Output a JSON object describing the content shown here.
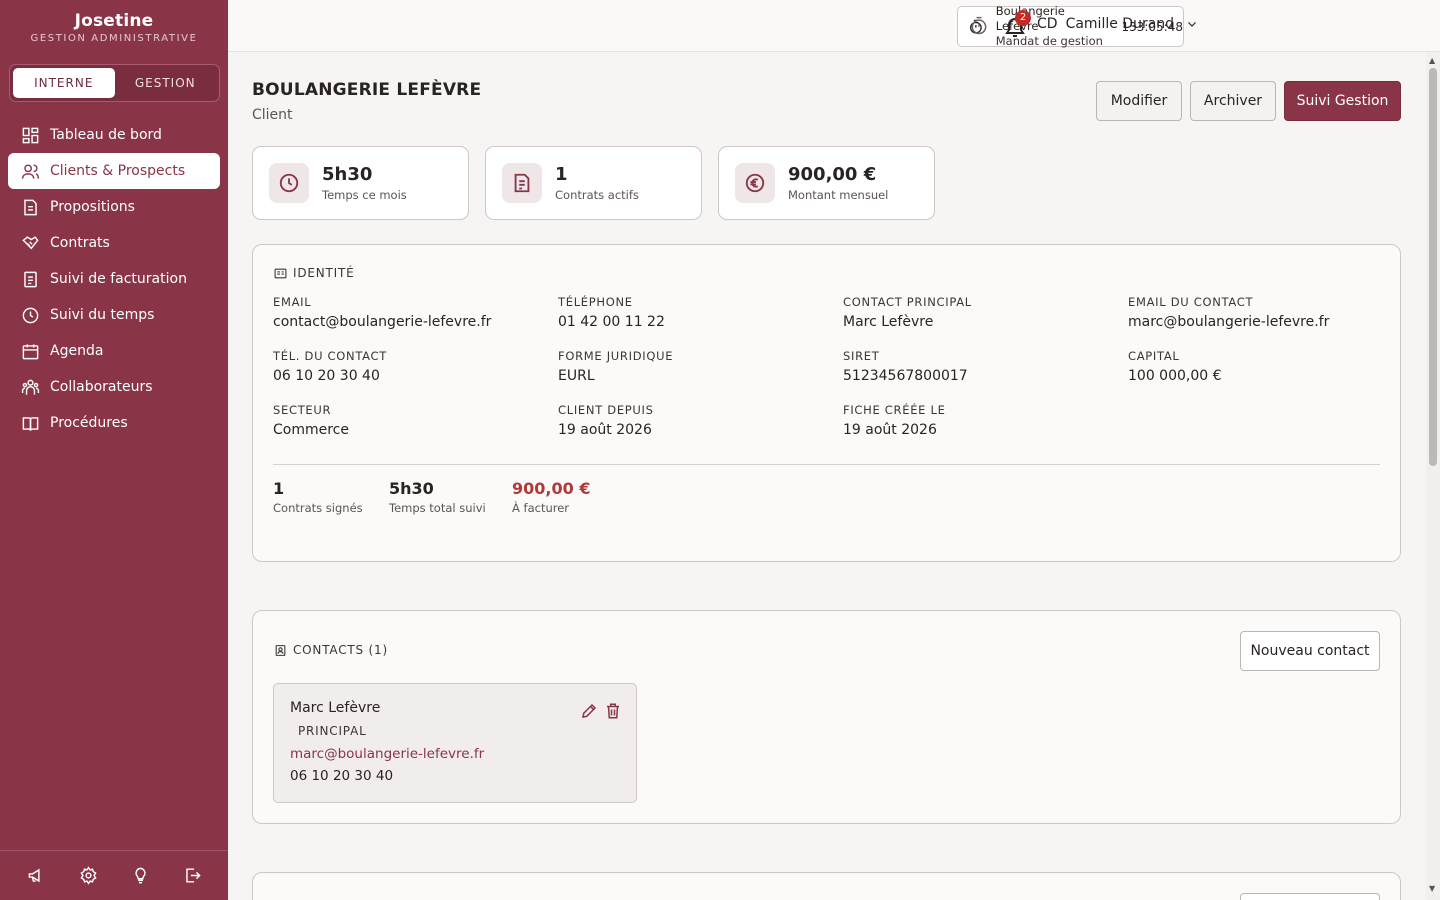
{
  "brand": {
    "name": "Josetine",
    "subtitle": "GESTION ADMINISTRATIVE"
  },
  "mode_toggle": {
    "options": [
      "INTERNE",
      "GESTION"
    ],
    "active": "INTERNE"
  },
  "sidebar": {
    "items": [
      {
        "label": "Tableau de bord",
        "icon": "dashboard-icon"
      },
      {
        "label": "Clients & Prospects",
        "icon": "users-icon",
        "active": true
      },
      {
        "label": "Propositions",
        "icon": "document-icon"
      },
      {
        "label": "Contrats",
        "icon": "handshake-icon"
      },
      {
        "label": "Suivi de facturation",
        "icon": "invoice-icon"
      },
      {
        "label": "Suivi du temps",
        "icon": "clock-icon"
      },
      {
        "label": "Agenda",
        "icon": "calendar-icon"
      },
      {
        "label": "Collaborateurs",
        "icon": "team-icon"
      },
      {
        "label": "Procédures",
        "icon": "book-icon"
      }
    ],
    "footer_icons": [
      "megaphone-icon",
      "settings-icon",
      "lightbulb-icon",
      "logout-icon"
    ]
  },
  "topbar": {
    "timer": {
      "title": "Boulangerie Lefèvre",
      "subtitle": "Mandat de gestion",
      "elapsed": "133:05:48"
    },
    "notifications_count": "2",
    "user": {
      "initials": "CD",
      "name": "Camille Durand"
    }
  },
  "page": {
    "title": "BOULANGERIE LEFÈVRE",
    "subtitle": "Client",
    "actions": {
      "edit": "Modifier",
      "archive": "Archiver",
      "primary": "Suivi Gestion"
    }
  },
  "stats": [
    {
      "value": "5h30",
      "label": "Temps ce mois",
      "icon": "clock-icon"
    },
    {
      "value": "1",
      "label": "Contrats actifs",
      "icon": "contract-icon"
    },
    {
      "value": "900,00 €",
      "label": "Montant mensuel",
      "icon": "euro-icon"
    }
  ],
  "identity": {
    "heading": "IDENTITÉ",
    "fields": [
      {
        "label": "EMAIL",
        "value": "contact@boulangerie-lefevre.fr"
      },
      {
        "label": "TÉLÉPHONE",
        "value": "01 42 00 11 22"
      },
      {
        "label": "CONTACT PRINCIPAL",
        "value": "Marc Lefèvre"
      },
      {
        "label": "EMAIL DU CONTACT",
        "value": "marc@boulangerie-lefevre.fr"
      },
      {
        "label": "TÉL. DU CONTACT",
        "value": "06 10 20 30 40"
      },
      {
        "label": "FORME JURIDIQUE",
        "value": "EURL"
      },
      {
        "label": "SIRET",
        "value": "51234567800017"
      },
      {
        "label": "CAPITAL",
        "value": "100 000,00 €"
      },
      {
        "label": "SECTEUR",
        "value": "Commerce"
      },
      {
        "label": "CLIENT DEPUIS",
        "value": "19 août 2026"
      },
      {
        "label": "FICHE CRÉÉE LE",
        "value": "19 août 2026"
      }
    ],
    "summary": [
      {
        "value": "1",
        "label": "Contrats signés"
      },
      {
        "value": "5h30",
        "label": "Temps total suivi"
      },
      {
        "value": "900,00 €",
        "label": "À facturer"
      }
    ]
  },
  "contacts": {
    "heading": "CONTACTS (1)",
    "new_button": "Nouveau contact",
    "items": [
      {
        "name": "Marc Lefèvre",
        "role": "PRINCIPAL",
        "email": "marc@boulangerie-lefevre.fr",
        "phone": "06 10 20 30 40"
      }
    ]
  },
  "colors": {
    "brand": "#8a3448",
    "accent_amount": "#b03a3a",
    "badge": "#c62828"
  }
}
